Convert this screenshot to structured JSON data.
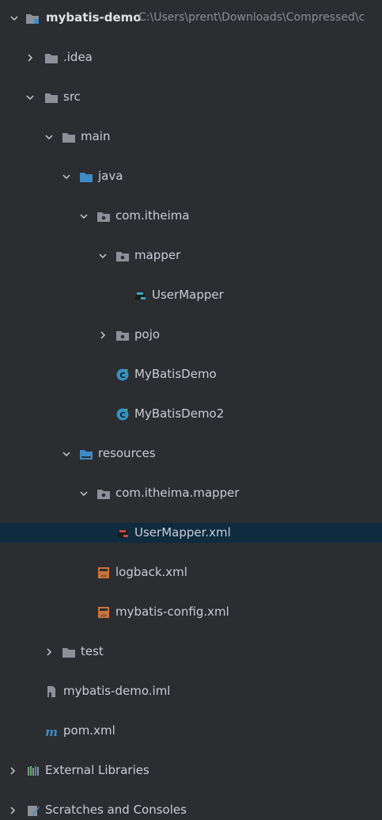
{
  "project_tree": {
    "root": {
      "label": "mybatis-demo",
      "path": "C:\\Users\\prent\\Downloads\\Compressed\\c"
    },
    "idea": {
      "label": ".idea"
    },
    "src": {
      "label": "src"
    },
    "main": {
      "label": "main"
    },
    "java": {
      "label": "java"
    },
    "com_itheima": {
      "label": "com.itheima"
    },
    "mapper": {
      "label": "mapper"
    },
    "user_mapper": {
      "label": "UserMapper"
    },
    "pojo": {
      "label": "pojo"
    },
    "mybatis_demo_class": {
      "label": "MyBatisDemo"
    },
    "mybatis_demo2_class": {
      "label": "MyBatisDemo2"
    },
    "resources": {
      "label": "resources"
    },
    "com_itheima_mapper": {
      "label": "com.itheima.mapper"
    },
    "user_mapper_xml": {
      "label": "UserMapper.xml"
    },
    "logback_xml": {
      "label": "logback.xml"
    },
    "mybatis_config_xml": {
      "label": "mybatis-config.xml"
    },
    "test": {
      "label": "test"
    },
    "iml": {
      "label": "mybatis-demo.iml"
    },
    "pom": {
      "label": "pom.xml"
    },
    "external_libraries": {
      "label": "External Libraries"
    },
    "scratches": {
      "label": "Scratches and Consoles"
    }
  },
  "colors": {
    "background": "#2b2d30",
    "selection": "#0e2b40",
    "folder": "#8c9199",
    "source_folder": "#3d8cc6",
    "class_icon": "#3592c4",
    "xml_icon": "#c9733a"
  },
  "selected_item": "UserMapper.xml"
}
